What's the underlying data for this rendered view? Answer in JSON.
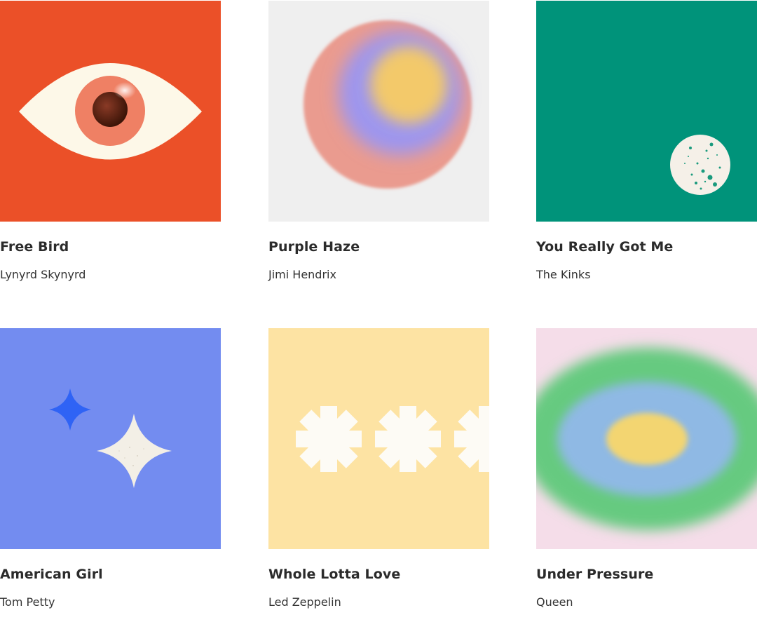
{
  "albums": [
    {
      "title": "Free Bird",
      "artist": "Lynyrd Skynyrd",
      "cover_color": "#eb5028",
      "art": "eye-icon"
    },
    {
      "title": "Purple Haze",
      "artist": "Jimi Hendrix",
      "cover_color": "#efefef",
      "art": "haze-orbs-icon"
    },
    {
      "title": "You Really Got Me",
      "artist": "The Kinks",
      "cover_color": "#00937a",
      "art": "speckled-moon-icon"
    },
    {
      "title": "American Girl",
      "artist": "Tom Petty",
      "cover_color": "#738cf0",
      "art": "sparkles-icon"
    },
    {
      "title": "Whole Lotta Love",
      "artist": "Led Zeppelin",
      "cover_color": "#fde3a3",
      "art": "gear-flowers-icon"
    },
    {
      "title": "Under Pressure",
      "artist": "Queen",
      "cover_color": "#f5dde9",
      "art": "pressure-rings-icon"
    }
  ]
}
